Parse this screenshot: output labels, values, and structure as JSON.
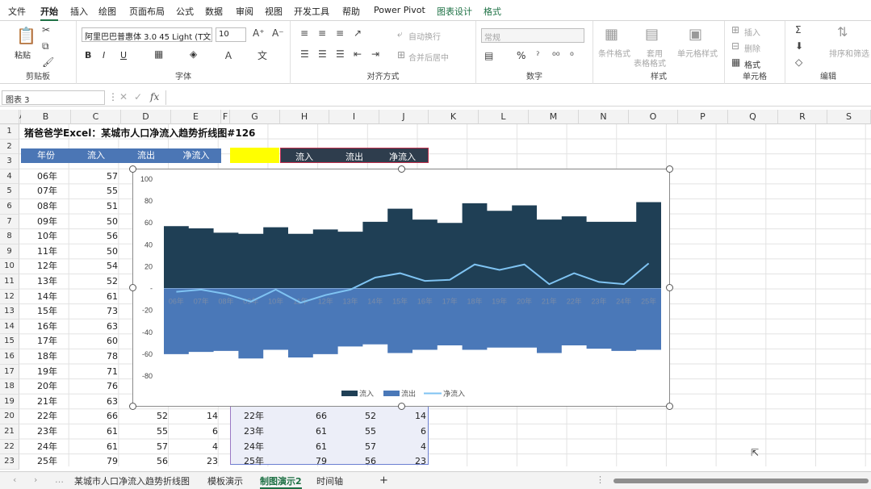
{
  "ribbon": {
    "tabs": [
      "文件",
      "开始",
      "插入",
      "绘图",
      "页面布局",
      "公式",
      "数据",
      "审阅",
      "视图",
      "开发工具",
      "帮助",
      "Power Pivot",
      "图表设计",
      "格式"
    ],
    "clipboard": {
      "paste": "粘贴",
      "label": "剪贴板"
    },
    "font": {
      "name": "阿里巴巴普惠体 3.0 45 Light (T文",
      "size": "10",
      "label": "字体",
      "bold": "B",
      "italic": "I",
      "underline": "U"
    },
    "alignment": {
      "wrap": "自动换行",
      "merge": "合并后居中",
      "label": "对齐方式"
    },
    "number": {
      "format": "常规",
      "percent": "%",
      "label": "数字"
    },
    "styles": {
      "cond": "条件格式",
      "table_line1": "套用",
      "table_line2": "表格格式",
      "cell": "单元格样式",
      "label": "样式"
    },
    "cells": {
      "insert": "插入",
      "delete": "删除",
      "format": "格式",
      "label": "单元格"
    },
    "editing": {
      "sort": "排序和筛选",
      "label": "编辑"
    }
  },
  "formula_bar": {
    "name_box": "图表 3",
    "fx": "fx"
  },
  "columns": [
    "A",
    "B",
    "C",
    "D",
    "E",
    "F",
    "G",
    "H",
    "I",
    "J",
    "K",
    "L",
    "M",
    "N",
    "O",
    "P",
    "Q",
    "R",
    "S"
  ],
  "rows": [
    "1",
    "2",
    "3",
    "4",
    "5",
    "6",
    "7",
    "8",
    "9",
    "10",
    "11",
    "12",
    "13",
    "14",
    "15",
    "16",
    "17",
    "18",
    "19",
    "20",
    "21",
    "22",
    "23"
  ],
  "sheet_title": "猪爸爸学Excel：某城市人口净流入趋势折线图#126",
  "table_headers": [
    "年份",
    "流入",
    "流出",
    "净流入"
  ],
  "table_rows": [
    [
      "06年",
      "57"
    ],
    [
      "07年",
      "55"
    ],
    [
      "08年",
      "51"
    ],
    [
      "09年",
      "50"
    ],
    [
      "10年",
      "56"
    ],
    [
      "11年",
      "50"
    ],
    [
      "12年",
      "54"
    ],
    [
      "13年",
      "52"
    ],
    [
      "14年",
      "61"
    ],
    [
      "15年",
      "73"
    ],
    [
      "16年",
      "63"
    ],
    [
      "17年",
      "60"
    ],
    [
      "18年",
      "78"
    ],
    [
      "19年",
      "71"
    ],
    [
      "20年",
      "76"
    ],
    [
      "21年",
      "63"
    ]
  ],
  "bottom_rows": [
    [
      "22年",
      "66",
      "52",
      "14",
      "22年",
      "66",
      "52",
      "14"
    ],
    [
      "23年",
      "61",
      "55",
      "6",
      "23年",
      "61",
      "55",
      "6"
    ],
    [
      "24年",
      "61",
      "57",
      "4",
      "24年",
      "61",
      "57",
      "4"
    ],
    [
      "25年",
      "79",
      "56",
      "23",
      "25年",
      "79",
      "56",
      "23"
    ]
  ],
  "helper_headers": [
    "流入",
    "流出",
    "净流入"
  ],
  "chart_data": {
    "type": "area",
    "categories": [
      "06年",
      "07年",
      "08年",
      "09年",
      "10年",
      "11年",
      "12年",
      "13年",
      "14年",
      "15年",
      "16年",
      "17年",
      "18年",
      "19年",
      "20年",
      "21年",
      "22年",
      "23年",
      "24年",
      "25年"
    ],
    "series": [
      {
        "name": "流入",
        "color": "#1f3f55",
        "values": [
          57,
          55,
          51,
          50,
          56,
          50,
          54,
          52,
          61,
          73,
          63,
          60,
          78,
          71,
          76,
          63,
          66,
          61,
          61,
          79
        ]
      },
      {
        "name": "流出",
        "color": "#4a78b8",
        "values": [
          -60,
          -58,
          -57,
          -64,
          -56,
          -63,
          -60,
          -53,
          -51,
          -59,
          -56,
          -52,
          -56,
          -54,
          -54,
          -59,
          -52,
          -55,
          -57,
          -56
        ]
      },
      {
        "name": "净流入",
        "color": "#7fc3f2",
        "values": [
          -3,
          -1,
          -5,
          -12,
          -1,
          -13,
          -6,
          -1,
          10,
          14,
          7,
          8,
          22,
          17,
          22,
          4,
          14,
          6,
          4,
          23
        ]
      }
    ],
    "yticks": [
      "100",
      "80",
      "60",
      "40",
      "20",
      "-",
      "-20",
      "-40",
      "-60",
      "-80"
    ],
    "ylim": [
      -80,
      100
    ]
  },
  "sheet_tabs": [
    "某城市人口净流入趋势折线图",
    "模板演示",
    "制图演示2",
    "时间轴"
  ],
  "sheet_add": "+"
}
